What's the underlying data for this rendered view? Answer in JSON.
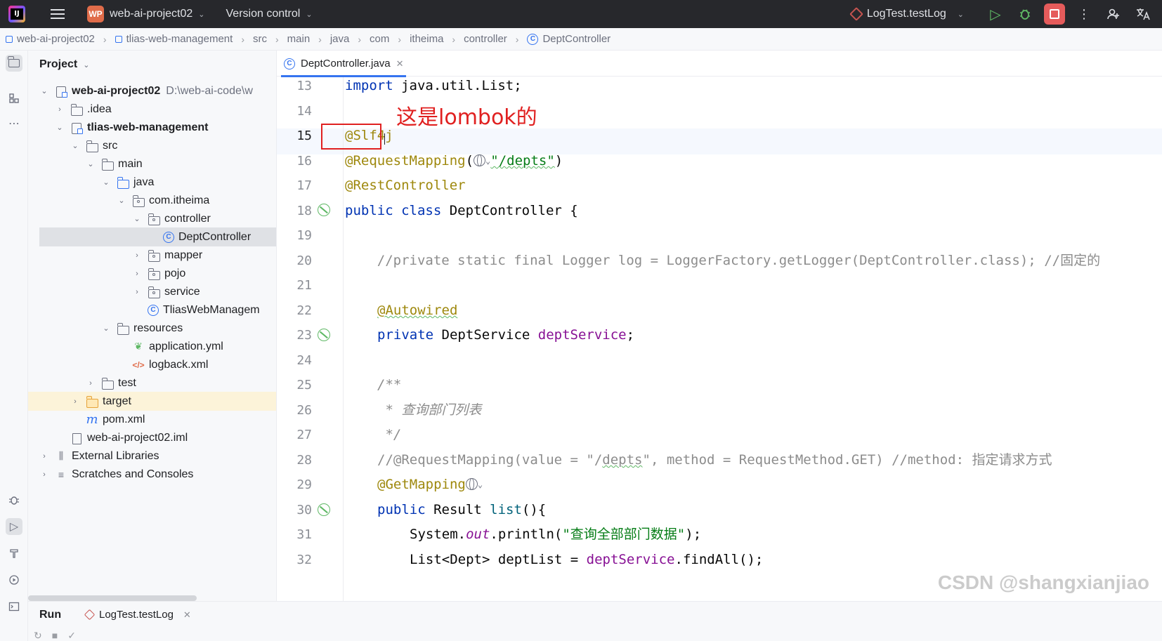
{
  "titlebar": {
    "project_badge": "WP",
    "project_name": "web-ai-project02",
    "vcs": "Version control",
    "run_config": "LogTest.testLog"
  },
  "breadcrumb": [
    "web-ai-project02",
    "tlias-web-management",
    "src",
    "main",
    "java",
    "com",
    "itheima",
    "controller",
    "DeptController"
  ],
  "project_panel": {
    "title": "Project",
    "root_path": "D:\\web-ai-code\\w",
    "tree": [
      {
        "label": "web-ai-project02"
      },
      {
        "label": ".idea"
      },
      {
        "label": "tlias-web-management"
      },
      {
        "label": "src"
      },
      {
        "label": "main"
      },
      {
        "label": "java"
      },
      {
        "label": "com.itheima"
      },
      {
        "label": "controller"
      },
      {
        "label": "DeptController"
      },
      {
        "label": "mapper"
      },
      {
        "label": "pojo"
      },
      {
        "label": "service"
      },
      {
        "label": "TliasWebManagem"
      },
      {
        "label": "resources"
      },
      {
        "label": "application.yml"
      },
      {
        "label": "logback.xml"
      },
      {
        "label": "test"
      },
      {
        "label": "target"
      },
      {
        "label": "pom.xml"
      },
      {
        "label": "web-ai-project02.iml"
      },
      {
        "label": "External Libraries"
      },
      {
        "label": "Scratches and Consoles"
      }
    ]
  },
  "editor": {
    "tab": "DeptController.java",
    "line_numbers": [
      "13",
      "14",
      "15",
      "16",
      "17",
      "18",
      "19",
      "20",
      "21",
      "22",
      "23",
      "24",
      "25",
      "26",
      "27",
      "28",
      "29",
      "30",
      "31",
      "32"
    ],
    "code": {
      "l13_kw": "import",
      "l13_rest": " java.util.List;",
      "l15_ann": "@Slf4j",
      "l16_ann": "@RequestMapping",
      "l16_open": "(",
      "l16_str": "\"/depts\"",
      "l16_close": ")",
      "l17_ann": "@RestController",
      "l18_kw": "public class",
      "l18_rest": " DeptController {",
      "l20_cmt": "    //private static final Logger log = LoggerFactory.getLogger(DeptController.class); //固定的",
      "l22_ann": "@Autowired",
      "l23_kw": "private",
      "l23_type": " DeptService ",
      "l23_fld": "deptService",
      "l23_end": ";",
      "l25_doc": "/**",
      "l26_doc": " * 查询部门列表",
      "l27_doc": " */",
      "l28_cmt_a": "//@RequestMapping(value = \"/",
      "l28_cmt_b": "depts",
      "l28_cmt_c": "\", method = RequestMethod.GET) //method: 指定请求方式",
      "l29_ann": "@GetMapping",
      "l30_kw": "public",
      "l30_rest": " Result ",
      "l30_fn": "list",
      "l30_end": "(){",
      "l31_a": "System.",
      "l31_out": "out",
      "l31_b": ".println(",
      "l31_str": "\"查询全部部门数据\"",
      "l31_c": ");",
      "l32_a": "List<Dept> deptList = ",
      "l32_fld": "deptService",
      "l32_b": ".findAll();"
    },
    "annotation_overlay": "这是lombok的"
  },
  "run_panel": {
    "title": "Run",
    "tab": "LogTest.testLog"
  },
  "watermark": "CSDN @shangxianjiao",
  "colors": {
    "titlebar_bg": "#27282c",
    "accent": "#3574f0",
    "highlight_box": "#e02020",
    "stop_button": "#e55b5b"
  }
}
